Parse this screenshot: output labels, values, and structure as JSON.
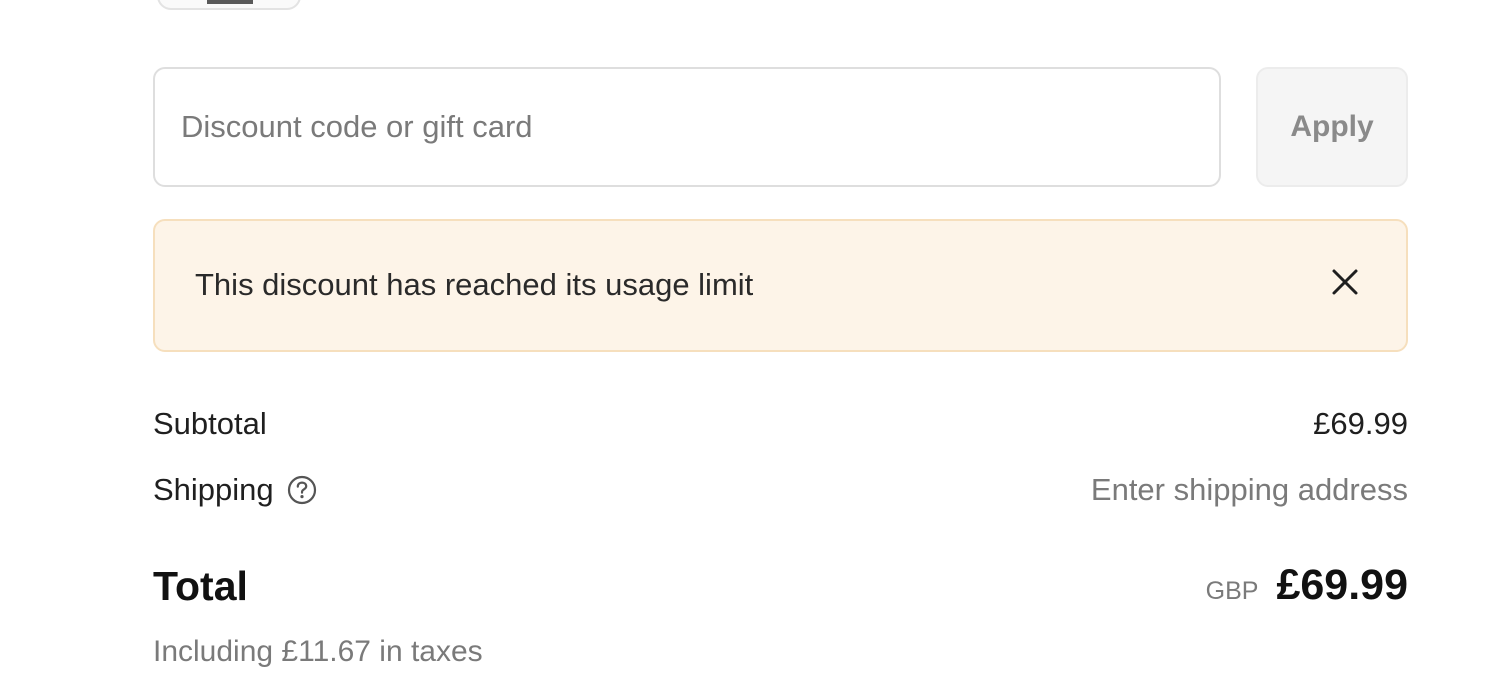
{
  "discount": {
    "placeholder": "Discount code or gift card",
    "value": "",
    "apply_label": "Apply"
  },
  "alert": {
    "message": "This discount has reached its usage limit",
    "close_icon": "close-icon",
    "background_color": "#fdf4e8",
    "border_color": "#f6dfbd"
  },
  "summary": {
    "subtotal_label": "Subtotal",
    "subtotal_value": "£69.99",
    "shipping_label": "Shipping",
    "shipping_help_icon": "question-circle-icon",
    "shipping_value": "Enter shipping address",
    "total_label": "Total",
    "currency": "GBP",
    "total_value": "£69.99",
    "tax_note": "Including £11.67 in taxes"
  }
}
